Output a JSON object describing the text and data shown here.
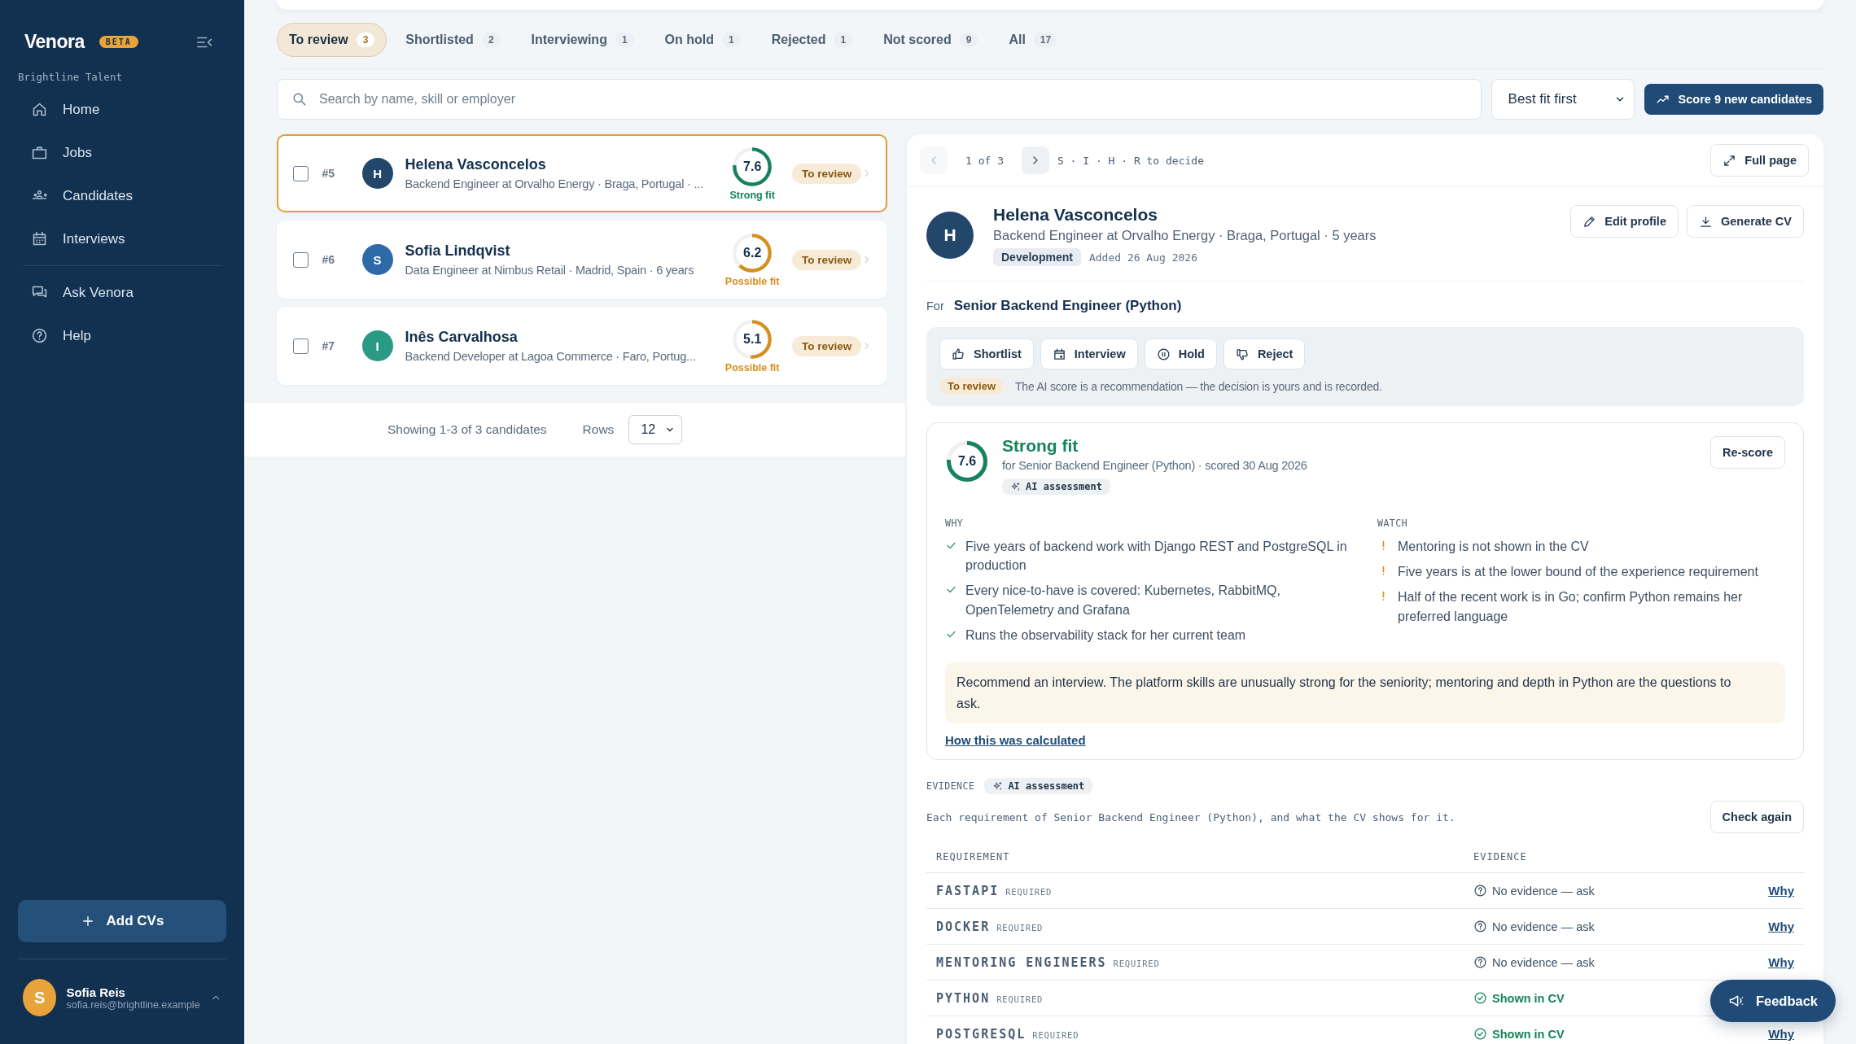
{
  "sidebar": {
    "logo": "Venora",
    "badge": "BETA",
    "org": "Brightline Talent",
    "nav": [
      {
        "label": "Home",
        "selected": false
      },
      {
        "label": "Jobs",
        "selected": false
      },
      {
        "label": "Candidates",
        "selected": false
      },
      {
        "label": "Interviews",
        "selected": false
      }
    ],
    "nav_secondary": [
      {
        "label": "Ask Venora",
        "selected": false
      },
      {
        "label": "Help",
        "selected": false
      }
    ],
    "add_button": "Add CVs",
    "user": {
      "initial": "S",
      "name": "Sofia Reis",
      "email": "sofia.reis@brightline.example"
    }
  },
  "tabs": [
    {
      "label": "To review",
      "count": "3",
      "selected": true
    },
    {
      "label": "Shortlisted",
      "count": "2",
      "selected": false
    },
    {
      "label": "Interviewing",
      "count": "1",
      "selected": false
    },
    {
      "label": "On hold",
      "count": "1",
      "selected": false
    },
    {
      "label": "Rejected",
      "count": "1",
      "selected": false
    },
    {
      "label": "Not scored",
      "count": "9",
      "selected": false
    },
    {
      "label": "All",
      "count": "17",
      "selected": false
    }
  ],
  "search": {
    "placeholder": "Search by name, skill or employer"
  },
  "sort": {
    "value": "Best fit first"
  },
  "score_button": "Score 9 new candidates",
  "candidates": [
    {
      "number": "#5",
      "initial": "H",
      "color": "#23466b",
      "name": "Helena Vasconcelos",
      "subtitle": "Backend Engineer at Orvalho Energy · Braga, Portugal · ...",
      "score": "7.6",
      "level": 0.76,
      "fit": {
        "label": "Strong fit",
        "color": "#16835a"
      },
      "status": "To review",
      "selected": true,
      "checked": false
    },
    {
      "number": "#6",
      "initial": "S",
      "color": "#2f6aa8",
      "name": "Sofia Lindqvist",
      "subtitle": "Data Engineer at Nimbus Retail · Madrid, Spain · 6 years",
      "score": "6.2",
      "level": 0.62,
      "fit": {
        "label": "Possible fit",
        "color": "#d4901f"
      },
      "status": "To review",
      "selected": false,
      "checked": false
    },
    {
      "number": "#7",
      "initial": "I",
      "color": "#2a9a84",
      "name": "Inês Carvalhosa",
      "subtitle": "Backend Developer at Lagoa Commerce · Faro, Portug...",
      "score": "5.1",
      "level": 0.51,
      "fit": {
        "label": "Possible fit",
        "color": "#d4901f"
      },
      "status": "To review",
      "selected": false,
      "checked": false
    }
  ],
  "pagination": {
    "text": "Showing 1-3 of 3 candidates",
    "rows_label": "Rows",
    "rows_value": "12"
  },
  "detail": {
    "position": "1 of 3",
    "hint": "S · I · H · R to decide",
    "full_page": "Full page",
    "profile": {
      "initial": "H",
      "name": "Helena Vasconcelos",
      "subtitle": "Backend Engineer at Orvalho Energy · Braga, Portugal · 5 years",
      "tag": "Development",
      "added": "Added 26 Aug 2026"
    },
    "profile_actions": [
      "Edit profile",
      "Generate CV"
    ],
    "for_label": "For",
    "job": "Senior Backend Engineer (Python)",
    "decisions": [
      "Shortlist",
      "Interview",
      "Hold",
      "Reject"
    ],
    "status": "To review",
    "disclaimer": "The AI score is a recommendation — the decision is yours and is recorded.",
    "assessment": {
      "score": "7.6",
      "level": 0.76,
      "verdict": "Strong fit",
      "meta": "for Senior Backend Engineer (Python) · scored 30 Aug 2026",
      "badge": "AI assessment",
      "rescore": "Re-score",
      "why_heading": "WHY",
      "why": [
        "Five years of backend work with Django REST and PostgreSQL in production",
        "Every nice-to-have is covered: Kubernetes, RabbitMQ, OpenTelemetry and Grafana",
        "Runs the observability stack for her current team"
      ],
      "watch_heading": "WATCH",
      "watch": [
        "Mentoring is not shown in the CV",
        "Five years is at the lower bound of the experience requirement",
        "Half of the recent work is in Go; confirm Python remains her preferred language"
      ],
      "summary": "Recommend an interview. The platform skills are unusually strong for the seniority; mentoring and depth in Python are the questions to ask.",
      "link": "How this was calculated"
    },
    "evidence": {
      "heading": "EVIDENCE",
      "badge": "AI assessment",
      "description": "Each requirement of Senior Backend Engineer (Python), and what the CV shows for it.",
      "check_again": "Check again",
      "columns": [
        "REQUIREMENT",
        "EVIDENCE"
      ],
      "rows": [
        {
          "requirement": "FASTAPI",
          "tag": "REQUIRED",
          "evidence": "No evidence — ask",
          "kind": "missing",
          "why": "Why"
        },
        {
          "requirement": "DOCKER",
          "tag": "REQUIRED",
          "evidence": "No evidence — ask",
          "kind": "missing",
          "why": "Why"
        },
        {
          "requirement": "MENTORING ENGINEERS",
          "tag": "REQUIRED",
          "evidence": "No evidence — ask",
          "kind": "missing",
          "why": "Why"
        },
        {
          "requirement": "PYTHON",
          "tag": "REQUIRED",
          "evidence": "Shown in CV",
          "kind": "shown"
        },
        {
          "requirement": "POSTGRESQL",
          "tag": "REQUIRED",
          "evidence": "Shown in CV",
          "kind": "shown",
          "why": "Why"
        }
      ]
    }
  },
  "feedback": "Feedback"
}
